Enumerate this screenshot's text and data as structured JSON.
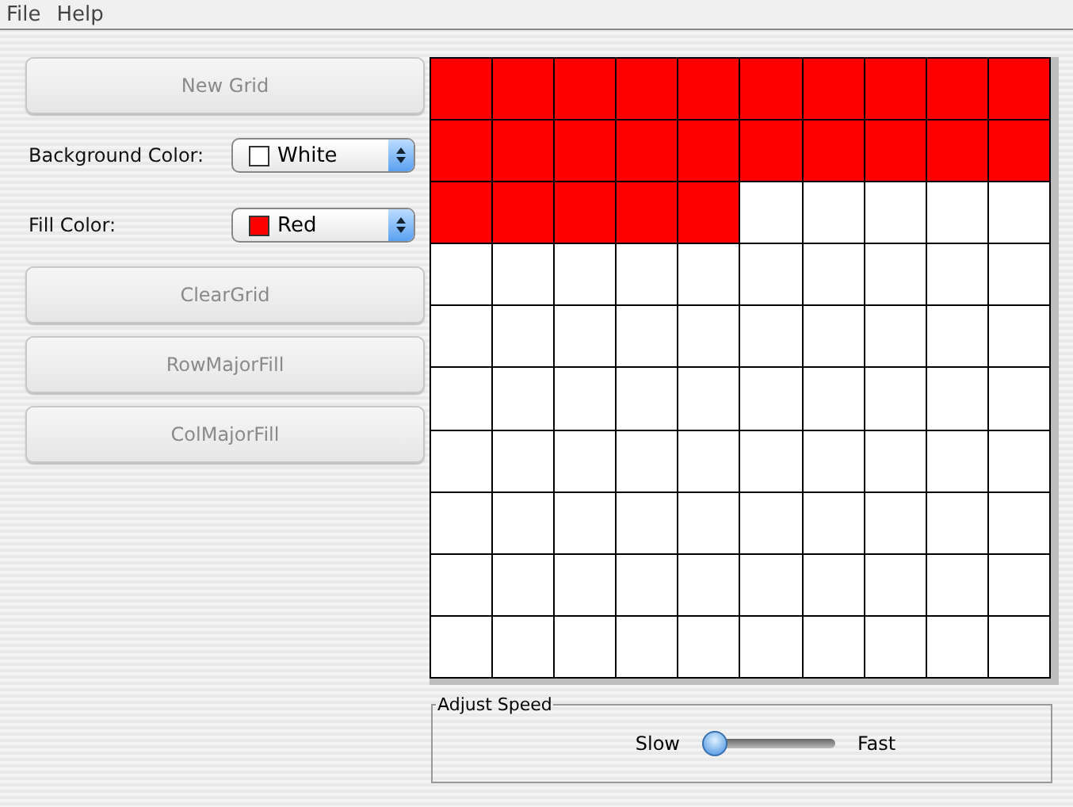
{
  "menu": [
    {
      "label": "File"
    },
    {
      "label": "Help"
    }
  ],
  "new_grid_button": {
    "label": "New Grid",
    "disabled": true
  },
  "background_color": {
    "label": "Background Color:",
    "value": "White",
    "color": "#ffffff"
  },
  "fill_color": {
    "label": "Fill Color:",
    "value": "Red",
    "color": "#ff0000"
  },
  "buttons": [
    {
      "label": "ClearGrid",
      "disabled": true
    },
    {
      "label": "RowMajorFill",
      "disabled": true
    },
    {
      "label": "ColMajorFill",
      "disabled": true
    }
  ],
  "grid": {
    "rows": [
      [
        true,
        true,
        true,
        true,
        true,
        true,
        true,
        true,
        true,
        true
      ],
      [
        true,
        true,
        true,
        true,
        true,
        true,
        true,
        true,
        true,
        true
      ],
      [
        true,
        true,
        true,
        true,
        true,
        false,
        false,
        false,
        false,
        false
      ],
      [
        false,
        false,
        false,
        false,
        false,
        false,
        false,
        false,
        false,
        false
      ],
      [
        false,
        false,
        false,
        false,
        false,
        false,
        false,
        false,
        false,
        false
      ],
      [
        false,
        false,
        false,
        false,
        false,
        false,
        false,
        false,
        false,
        false
      ],
      [
        false,
        false,
        false,
        false,
        false,
        false,
        false,
        false,
        false,
        false
      ],
      [
        false,
        false,
        false,
        false,
        false,
        false,
        false,
        false,
        false,
        false
      ],
      [
        false,
        false,
        false,
        false,
        false,
        false,
        false,
        false,
        false,
        false
      ],
      [
        false,
        false,
        false,
        false,
        false,
        false,
        false,
        false,
        false,
        false
      ]
    ]
  },
  "speed": {
    "title": "Adjust Speed",
    "min_label": "Slow",
    "max_label": "Fast",
    "level": 0
  }
}
